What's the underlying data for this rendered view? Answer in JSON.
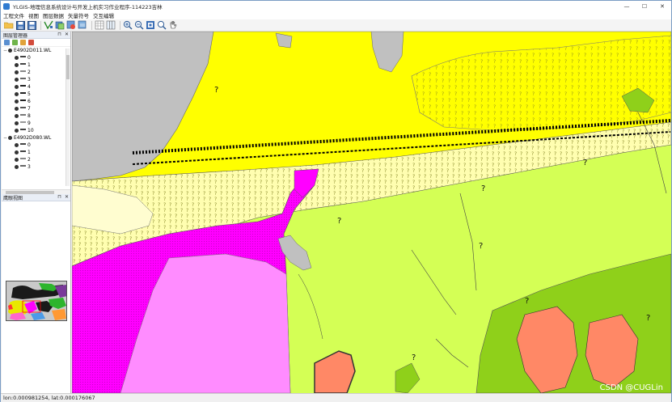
{
  "window": {
    "title": "YLGIS-地理信息系统设计与开发上机实习作业程序-114223吉林",
    "controls": {
      "minimize": "—",
      "maximize": "☐",
      "close": "✕"
    }
  },
  "menu": [
    "工程文件",
    "视图",
    "图层数据",
    "矢量符号",
    "交互编辑"
  ],
  "toolbar": {
    "icons": [
      "open-folder-icon",
      "save-icon",
      "save-as-icon",
      "edit-vertex-icon",
      "add-layer-icon",
      "remove-layer-icon",
      "layer-properties-icon",
      "table-icon",
      "columns-icon",
      "zoom-in-icon",
      "zoom-out-icon",
      "full-extent-icon",
      "zoom-window-icon",
      "pan-hand-icon"
    ]
  },
  "layer_panel": {
    "title": "图层管理器",
    "buttons": {
      "pin": "⊓",
      "close": "✕"
    },
    "layers": [
      {
        "name": "E4902D011.WL",
        "classes": [
          "0",
          "1",
          "2",
          "3",
          "4",
          "5",
          "6",
          "7",
          "8",
          "9",
          "10"
        ]
      },
      {
        "name": "E4902D080.WL",
        "classes": [
          "0",
          "1",
          "2",
          "3"
        ]
      }
    ]
  },
  "overview_panel": {
    "title": "鹰眼视图",
    "buttons": {
      "pin": "⊓",
      "close": "✕"
    }
  },
  "status": {
    "coords": "lon:0.000981254, lat:0.000176067"
  },
  "watermark": "CSDN @CUGLin",
  "map": {
    "label": "?",
    "colors": {
      "yellow": "#ffff00",
      "lime": "#d4ff55",
      "magenta": "#ff00ff",
      "pink": "#ff8cff",
      "gray": "#c0c0c0",
      "olive": "#8fd01a",
      "salmon": "#ff8866",
      "hatch_bg": "#fffeb0"
    }
  }
}
